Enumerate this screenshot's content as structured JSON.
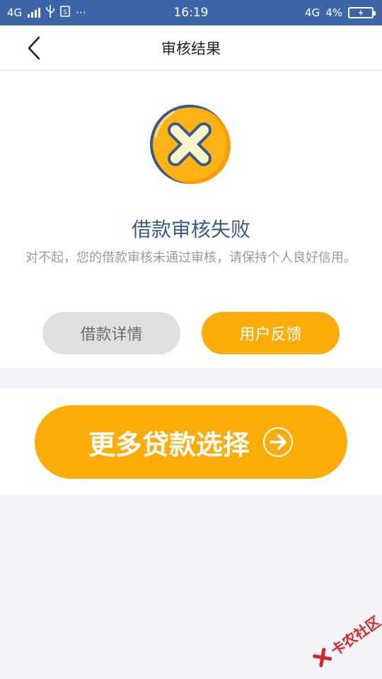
{
  "status_bar": {
    "network_left": "4G",
    "time": "16:19",
    "network_right": "4G",
    "battery": "4%",
    "more": "···"
  },
  "nav": {
    "title": "审核结果"
  },
  "result": {
    "title": "借款审核失败",
    "description": "对不起，您的借款审核未通过审核，请保持个人良好信用。",
    "detail_button": "借款详情",
    "feedback_button": "用户反馈"
  },
  "more_loans": {
    "button_label": "更多贷款选择"
  },
  "watermark": {
    "text": "卡农社区"
  },
  "colors": {
    "status_bar": "#3d66a8",
    "accent_orange": "#fdac0a",
    "title_blue": "#3b5a88",
    "gray_button": "#e0e0e0"
  },
  "icons": {
    "back": "chevron-left-icon",
    "fail": "fail-x-icon",
    "arrow": "arrow-right-circle-icon"
  }
}
